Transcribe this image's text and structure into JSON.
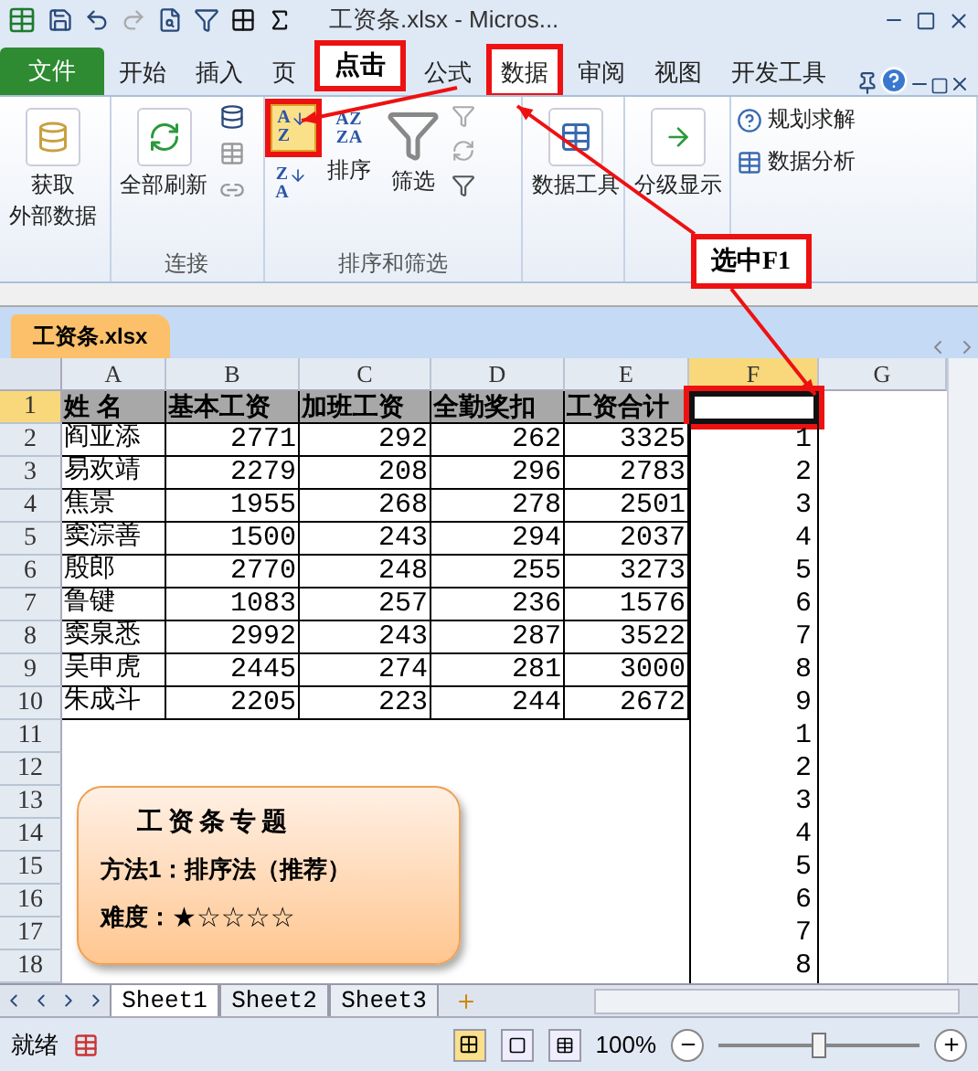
{
  "title_bar": {
    "title": "工资条.xlsx  -  Micros..."
  },
  "ribbon_tabs": [
    {
      "label": "文件",
      "kind": "file",
      "selected": false
    },
    {
      "label": "开始",
      "kind": "tab",
      "selected": false
    },
    {
      "label": "插入",
      "kind": "tab",
      "selected": false
    },
    {
      "label": "页",
      "kind": "tab",
      "selected": false
    },
    {
      "label": "公式",
      "kind": "tab",
      "selected": false
    },
    {
      "label": "数据",
      "kind": "tab",
      "selected": true
    },
    {
      "label": "审阅",
      "kind": "tab",
      "selected": false
    },
    {
      "label": "视图",
      "kind": "tab",
      "selected": false
    },
    {
      "label": "开发工具",
      "kind": "tab",
      "selected": false
    }
  ],
  "ribbon": {
    "external": [
      "获取",
      "外部数据"
    ],
    "refresh": "全部刷新",
    "connections_label": "连接",
    "az_letters": [
      "A",
      "Z"
    ],
    "za_letters": [
      "Z",
      "A"
    ],
    "sort_icon_letters": [
      "A",
      "Z",
      "Z",
      "A"
    ],
    "sort": "排序",
    "filter": "筛选",
    "sort_filter_label": "排序和筛选",
    "data_tools": "数据工具",
    "outline": "分级显示",
    "analysis": [
      "规划求解",
      "数据分析"
    ]
  },
  "annotations": [
    {
      "text": "点击"
    },
    {
      "text": "选中F1"
    }
  ],
  "workbook_tab": "工资条.xlsx",
  "columns": [
    {
      "label": "A",
      "selected": false
    },
    {
      "label": "B",
      "selected": false
    },
    {
      "label": "C",
      "selected": false
    },
    {
      "label": "D",
      "selected": false
    },
    {
      "label": "E",
      "selected": false
    },
    {
      "label": "F",
      "selected": true
    },
    {
      "label": "G",
      "selected": false
    }
  ],
  "rows": [
    {
      "number": "1",
      "selected": true,
      "kind": "header",
      "cells": [
        "姓  名",
        "基本工资",
        "加班工资",
        "全勤奖扣",
        "工资合计"
      ]
    },
    {
      "number": "2",
      "selected": false,
      "kind": "data",
      "cells": [
        "阎亚添",
        "2771",
        "292",
        "262",
        "3325"
      ],
      "f": "1"
    },
    {
      "number": "3",
      "selected": false,
      "kind": "data",
      "cells": [
        "易欢靖",
        "2279",
        "208",
        "296",
        "2783"
      ],
      "f": "2"
    },
    {
      "number": "4",
      "selected": false,
      "kind": "data",
      "cells": [
        "焦景",
        "1955",
        "268",
        "278",
        "2501"
      ],
      "f": "3"
    },
    {
      "number": "5",
      "selected": false,
      "kind": "data",
      "cells": [
        "窦淙善",
        "1500",
        "243",
        "294",
        "2037"
      ],
      "f": "4"
    },
    {
      "number": "6",
      "selected": false,
      "kind": "data",
      "cells": [
        "殷郎",
        "2770",
        "248",
        "255",
        "3273"
      ],
      "f": "5"
    },
    {
      "number": "7",
      "selected": false,
      "kind": "data",
      "cells": [
        "鲁键",
        "1083",
        "257",
        "236",
        "1576"
      ],
      "f": "6"
    },
    {
      "number": "8",
      "selected": false,
      "kind": "data",
      "cells": [
        "窦泉悉",
        "2992",
        "243",
        "287",
        "3522"
      ],
      "f": "7"
    },
    {
      "number": "9",
      "selected": false,
      "kind": "data",
      "cells": [
        "吴申虎",
        "2445",
        "274",
        "281",
        "3000"
      ],
      "f": "8"
    },
    {
      "number": "10",
      "selected": false,
      "kind": "data",
      "cells": [
        "朱成斗",
        "2205",
        "223",
        "244",
        "2672"
      ],
      "f": "9"
    },
    {
      "number": "11",
      "selected": false,
      "kind": "empty",
      "f": "1"
    },
    {
      "number": "12",
      "selected": false,
      "kind": "empty",
      "f": "2"
    },
    {
      "number": "13",
      "selected": false,
      "kind": "empty",
      "f": "3"
    },
    {
      "number": "14",
      "selected": false,
      "kind": "empty",
      "f": "4"
    },
    {
      "number": "15",
      "selected": false,
      "kind": "empty",
      "f": "5"
    },
    {
      "number": "16",
      "selected": false,
      "kind": "empty",
      "f": "6"
    },
    {
      "number": "17",
      "selected": false,
      "kind": "empty",
      "f": "7"
    },
    {
      "number": "18",
      "selected": false,
      "kind": "empty",
      "f": "8"
    }
  ],
  "note": {
    "title": "工资条专题",
    "method": "方法1：排序法（推荐）",
    "difficulty_label": "难度：",
    "stars": 1
  },
  "sheet_tabs": [
    {
      "label": "Sheet1",
      "selected": true
    },
    {
      "label": "Sheet2",
      "selected": false
    },
    {
      "label": "Sheet3",
      "selected": false
    }
  ],
  "status_bar": {
    "text": "就绪",
    "zoom": "100%",
    "zoom_slider": {
      "level": 0.5
    }
  }
}
